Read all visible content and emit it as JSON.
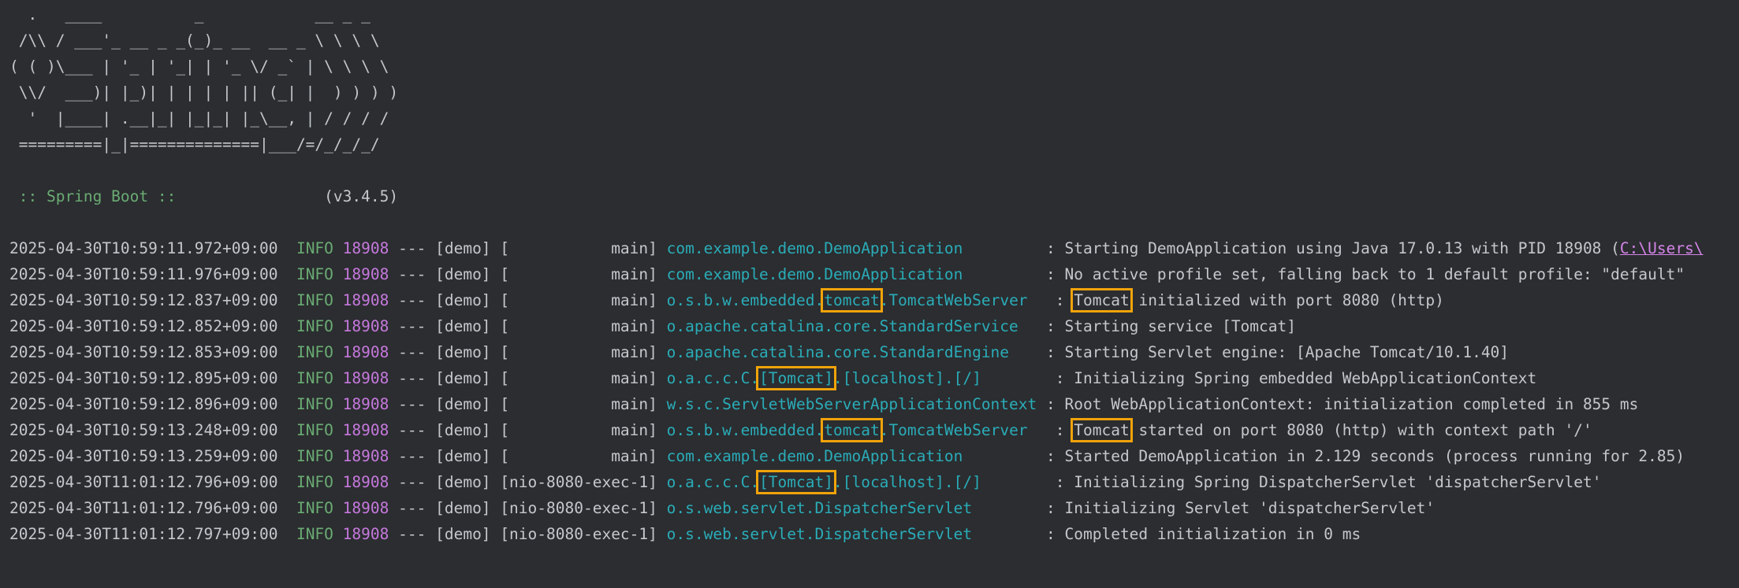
{
  "banner": [
    "  .   ____          _            __ _ _",
    " /\\\\ / ___'_ __ _ _(_)_ __  __ _ \\ \\ \\ \\",
    "( ( )\\___ | '_ | '_| | '_ \\/ _` | \\ \\ \\ \\",
    " \\\\/  ___)| |_)| | | | | || (_| |  ) ) ) )",
    "  '  |____| .__|_| |_|_| |_\\__, | / / / /",
    " =========|_|==============|___/=/_/_/_/"
  ],
  "spring": {
    "tag": " :: Spring Boot :: ",
    "version": "               (v3.4.5)"
  },
  "highlight_color": "#f0a30a",
  "colors": {
    "background": "#2b2d30",
    "text": "#c4c7cc",
    "level": "#6aab73",
    "pid": "#c678dd",
    "logger": "#2aacb8",
    "link": "#d484e8"
  },
  "log": [
    {
      "ts": "2025-04-30T10:59:11.972+09:00",
      "level": "INFO",
      "pid": "18908",
      "sep": "---",
      "app": "[demo]",
      "thread": "[           main]",
      "logger_pre": "com.example.demo.DemoApplication",
      "logger_hl": "",
      "logger_post": "",
      "logger_pad": "        ",
      "msg_hl": "",
      "msg": "Starting DemoApplication using Java 17.0.13 with PID 18908 (",
      "link": "C:\\Users\\"
    },
    {
      "ts": "2025-04-30T10:59:11.976+09:00",
      "level": "INFO",
      "pid": "18908",
      "sep": "---",
      "app": "[demo]",
      "thread": "[           main]",
      "logger_pre": "com.example.demo.DemoApplication",
      "logger_hl": "",
      "logger_post": "",
      "logger_pad": "        ",
      "msg_hl": "",
      "msg": "No active profile set, falling back to 1 default profile: \"default\"",
      "link": ""
    },
    {
      "ts": "2025-04-30T10:59:12.837+09:00",
      "level": "INFO",
      "pid": "18908",
      "sep": "---",
      "app": "[demo]",
      "thread": "[           main]",
      "logger_pre": "o.s.b.w.embedded.",
      "logger_hl": "tomcat",
      "logger_post": ".TomcatWebServer",
      "logger_pad": "  ",
      "msg_hl": "Tomcat",
      "msg": " initialized with port 8080 (http)",
      "link": ""
    },
    {
      "ts": "2025-04-30T10:59:12.852+09:00",
      "level": "INFO",
      "pid": "18908",
      "sep": "---",
      "app": "[demo]",
      "thread": "[           main]",
      "logger_pre": "o.apache.catalina.core.StandardService",
      "logger_hl": "",
      "logger_post": "",
      "logger_pad": "  ",
      "msg_hl": "",
      "msg": "Starting service [Tomcat]",
      "link": ""
    },
    {
      "ts": "2025-04-30T10:59:12.853+09:00",
      "level": "INFO",
      "pid": "18908",
      "sep": "---",
      "app": "[demo]",
      "thread": "[           main]",
      "logger_pre": "o.apache.catalina.core.StandardEngine",
      "logger_hl": "",
      "logger_post": "",
      "logger_pad": "   ",
      "msg_hl": "",
      "msg": "Starting Servlet engine: [Apache Tomcat/10.1.40]",
      "link": ""
    },
    {
      "ts": "2025-04-30T10:59:12.895+09:00",
      "level": "INFO",
      "pid": "18908",
      "sep": "---",
      "app": "[demo]",
      "thread": "[           main]",
      "logger_pre": "o.a.c.c.C.",
      "logger_hl": "[Tomcat]",
      "logger_post": ".[localhost].[/]",
      "logger_pad": "       ",
      "msg_hl": "",
      "msg": "Initializing Spring embedded WebApplicationContext",
      "link": ""
    },
    {
      "ts": "2025-04-30T10:59:12.896+09:00",
      "level": "INFO",
      "pid": "18908",
      "sep": "---",
      "app": "[demo]",
      "thread": "[           main]",
      "logger_pre": "w.s.c.ServletWebServerApplicationContext",
      "logger_hl": "",
      "logger_post": "",
      "logger_pad": "",
      "msg_hl": "",
      "msg": "Root WebApplicationContext: initialization completed in 855 ms",
      "link": ""
    },
    {
      "ts": "2025-04-30T10:59:13.248+09:00",
      "level": "INFO",
      "pid": "18908",
      "sep": "---",
      "app": "[demo]",
      "thread": "[           main]",
      "logger_pre": "o.s.b.w.embedded.",
      "logger_hl": "tomcat",
      "logger_post": ".TomcatWebServer",
      "logger_pad": "  ",
      "msg_hl": "Tomcat",
      "msg": " started on port 8080 (http) with context path '/'",
      "link": ""
    },
    {
      "ts": "2025-04-30T10:59:13.259+09:00",
      "level": "INFO",
      "pid": "18908",
      "sep": "---",
      "app": "[demo]",
      "thread": "[           main]",
      "logger_pre": "com.example.demo.DemoApplication",
      "logger_hl": "",
      "logger_post": "",
      "logger_pad": "        ",
      "msg_hl": "",
      "msg": "Started DemoApplication in 2.129 seconds (process running for 2.85)",
      "link": ""
    },
    {
      "ts": "2025-04-30T11:01:12.796+09:00",
      "level": "INFO",
      "pid": "18908",
      "sep": "---",
      "app": "[demo]",
      "thread": "[nio-8080-exec-1]",
      "logger_pre": "o.a.c.c.C.",
      "logger_hl": "[Tomcat]",
      "logger_post": ".[localhost].[/]",
      "logger_pad": "       ",
      "msg_hl": "",
      "msg": "Initializing Spring DispatcherServlet 'dispatcherServlet'",
      "link": ""
    },
    {
      "ts": "2025-04-30T11:01:12.796+09:00",
      "level": "INFO",
      "pid": "18908",
      "sep": "---",
      "app": "[demo]",
      "thread": "[nio-8080-exec-1]",
      "logger_pre": "o.s.web.servlet.DispatcherServlet",
      "logger_hl": "",
      "logger_post": "",
      "logger_pad": "       ",
      "msg_hl": "",
      "msg": "Initializing Servlet 'dispatcherServlet'",
      "link": ""
    },
    {
      "ts": "2025-04-30T11:01:12.797+09:00",
      "level": "INFO",
      "pid": "18908",
      "sep": "---",
      "app": "[demo]",
      "thread": "[nio-8080-exec-1]",
      "logger_pre": "o.s.web.servlet.DispatcherServlet",
      "logger_hl": "",
      "logger_post": "",
      "logger_pad": "       ",
      "msg_hl": "",
      "msg": "Completed initialization in 0 ms",
      "link": ""
    }
  ]
}
